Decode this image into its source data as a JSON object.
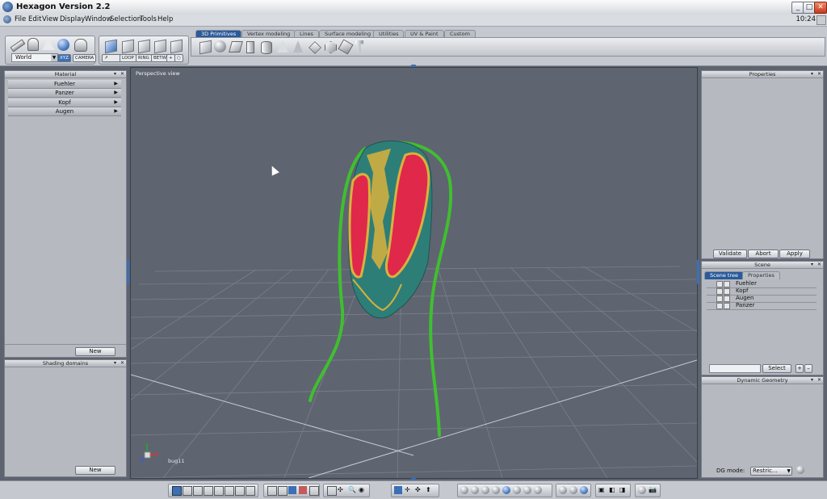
{
  "window": {
    "title": "Hexagon Version 2.2"
  },
  "menu": {
    "items": [
      "File",
      "Edit",
      "View",
      "Display",
      "Window",
      "Selection",
      "Tools",
      "Help"
    ],
    "clock": "10:24"
  },
  "toolbar": {
    "tabs": [
      "3D Primitives",
      "Vertex modeling",
      "Lines",
      "Surface modeling",
      "Utilities",
      "UV & Paint",
      "Custom"
    ],
    "active_tab": "3D Primitives",
    "coordinate_system": "World",
    "xyz_label": "XYZ",
    "camera_label": "CAMERA",
    "loop_label": "LOOP",
    "ring_label": "RING",
    "betw_label": "BETW"
  },
  "material_panel": {
    "title": "Material",
    "items": [
      "Fuehler",
      "Panzer",
      "Kopf",
      "Augen"
    ],
    "new_label": "New"
  },
  "shading_panel": {
    "title": "Shading domains",
    "new_label": "New"
  },
  "viewport": {
    "label": "Perspective view",
    "object_name": "bug11"
  },
  "properties_panel": {
    "title": "Properties",
    "validate_label": "Validate",
    "abort_label": "Abort",
    "apply_label": "Apply"
  },
  "scene_panel": {
    "title": "Scene",
    "tabs": [
      "Scene tree",
      "Properties"
    ],
    "items": [
      "Fuehler",
      "Kopf",
      "Augen",
      "Panzer"
    ],
    "select_label": "Select",
    "search_value": ""
  },
  "dynamic_panel": {
    "title": "Dynamic Geometry",
    "mode_label": "DG mode:",
    "mode_value": "Restric..."
  },
  "colors": {
    "accent": "#2a5a9a",
    "body_teal": "#2e7e78",
    "wing_red": "#e0284a",
    "antenna_green": "#3fbf2f",
    "pattern_yellow": "#d9b23c"
  }
}
